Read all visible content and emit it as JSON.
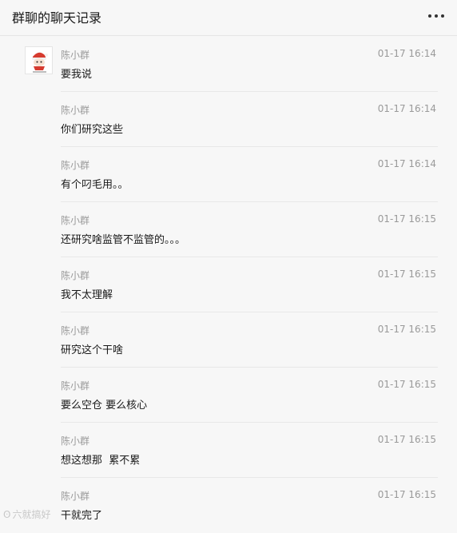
{
  "header": {
    "title": "群聊的聊天记录",
    "more_icon": "more-dots-icon"
  },
  "messages": [
    {
      "sender": "陈小群",
      "time": "01-17 16:14",
      "text": "要我说",
      "show_avatar": true
    },
    {
      "sender": "陈小群",
      "time": "01-17 16:14",
      "text": "你们研究这些"
    },
    {
      "sender": "陈小群",
      "time": "01-17 16:14",
      "text": "有个叼毛用。。"
    },
    {
      "sender": "陈小群",
      "time": "01-17 16:15",
      "text": "还研究啥监管不监管的。。。"
    },
    {
      "sender": "陈小群",
      "time": "01-17 16:15",
      "text": "我不太理解"
    },
    {
      "sender": "陈小群",
      "time": "01-17 16:15",
      "text": "研究这个干啥"
    },
    {
      "sender": "陈小群",
      "time": "01-17 16:15",
      "text": "要么空仓 要么核心"
    },
    {
      "sender": "陈小群",
      "time": "01-17 16:15",
      "text": "想这想那  累不累"
    },
    {
      "sender": "陈小群",
      "time": "01-17 16:15",
      "text": "干就完了"
    }
  ],
  "watermark": {
    "text": "六就搞好"
  }
}
